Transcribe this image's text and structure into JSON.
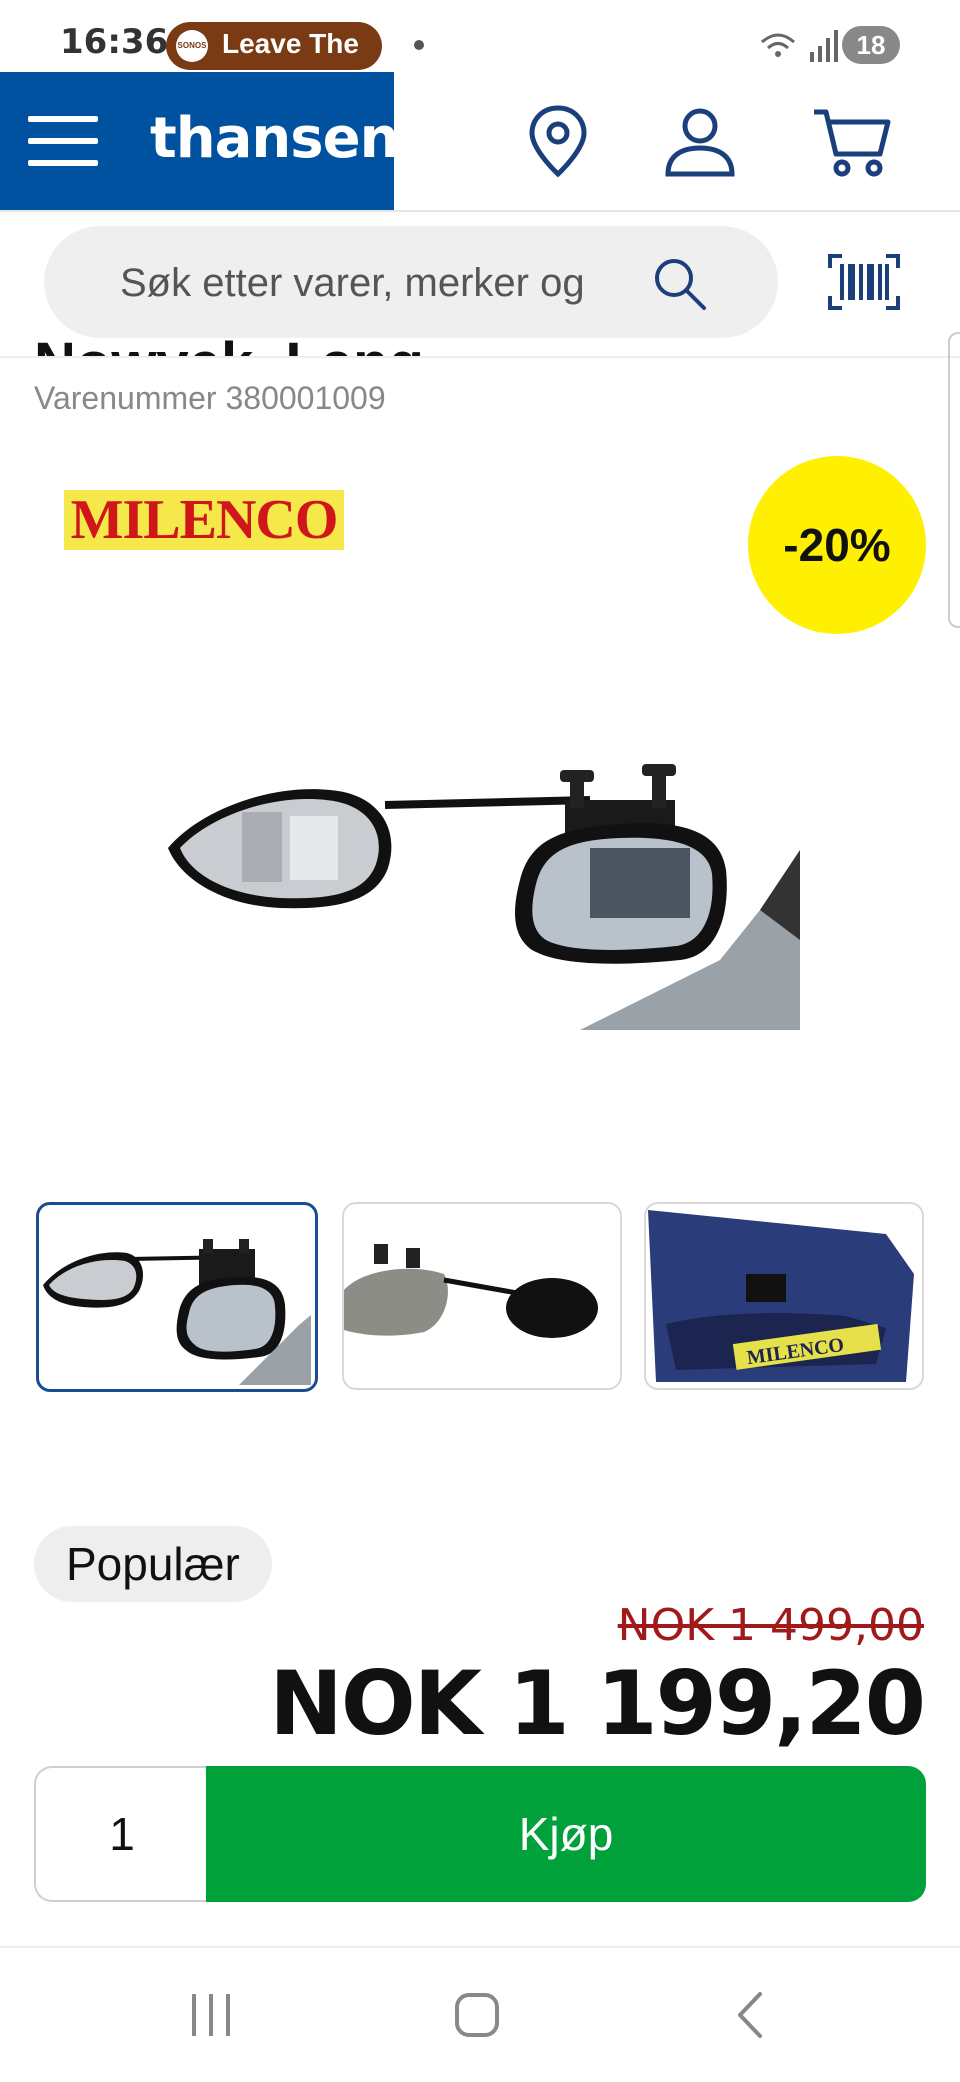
{
  "status_bar": {
    "time": "16:36",
    "media_app": "SONOS",
    "media_title": "Leave The",
    "badge": "18"
  },
  "header": {
    "brand": "thansen"
  },
  "search": {
    "placeholder": "Søk etter varer, merker og"
  },
  "product": {
    "title_partial": "Nowvek, Lang",
    "sku": "Varenummer 380001009",
    "brand_logo": "MILENCO",
    "discount": "-20%",
    "badge": "Populær",
    "old_price": "NOK 1 499,00",
    "new_price": "NOK 1 199,20"
  },
  "thumbnails": [
    {
      "name": "mirror-mounted",
      "active": true
    },
    {
      "name": "mirror-side-view",
      "active": false
    },
    {
      "name": "mirror-in-bag",
      "active": false,
      "bag_text": "MILENCO"
    }
  ],
  "purchase": {
    "quantity": "1",
    "buy_label": "Kjøp"
  },
  "colors": {
    "brand_blue": "#0052a0",
    "buy_green": "#00a13a",
    "discount_yellow": "#fef000",
    "old_price_red": "#a01a1a"
  }
}
